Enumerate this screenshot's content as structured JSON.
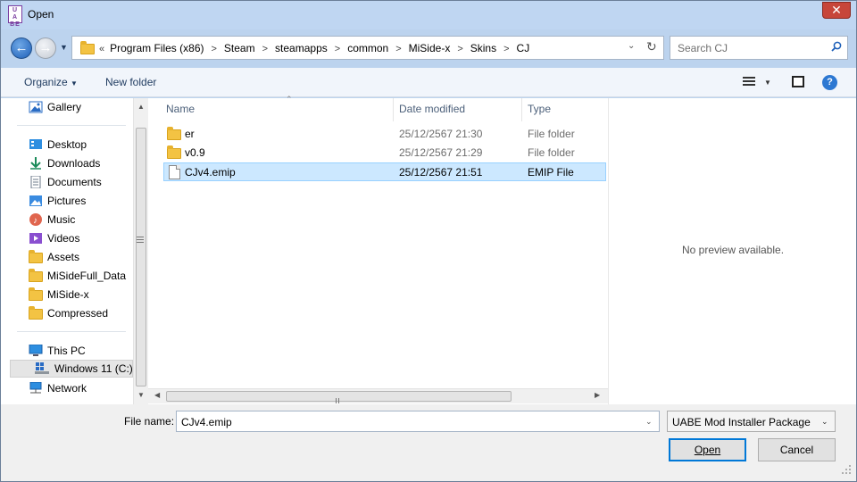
{
  "window": {
    "title": "Open",
    "app_icon_text": "UABE",
    "close_label": "✕"
  },
  "address": {
    "prefix": "«",
    "crumbs": [
      "Program Files (x86)",
      "Steam",
      "steamapps",
      "common",
      "MiSide-x",
      "Skins",
      "CJ"
    ]
  },
  "search": {
    "placeholder": "Search CJ"
  },
  "toolbar": {
    "organize_label": "Organize",
    "new_folder_label": "New folder"
  },
  "nav": {
    "items": [
      {
        "label": "Gallery",
        "icon": "gallery-icon"
      },
      {
        "label": "Desktop",
        "icon": "desktop-icon"
      },
      {
        "label": "Downloads",
        "icon": "download-icon"
      },
      {
        "label": "Documents",
        "icon": "documents-icon"
      },
      {
        "label": "Pictures",
        "icon": "pictures-icon"
      },
      {
        "label": "Music",
        "icon": "music-icon"
      },
      {
        "label": "Videos",
        "icon": "videos-icon"
      },
      {
        "label": "Assets",
        "icon": "folder-icon"
      },
      {
        "label": "MiSideFull_Data",
        "icon": "folder-icon"
      },
      {
        "label": "MiSide-x",
        "icon": "folder-icon"
      },
      {
        "label": "Compressed",
        "icon": "folder-icon"
      },
      {
        "label": "This PC",
        "icon": "computer-icon"
      },
      {
        "label": "Windows 11 (C:)",
        "icon": "drive-icon"
      },
      {
        "label": "Network",
        "icon": "network-icon"
      }
    ]
  },
  "file_list": {
    "columns": [
      "Name",
      "Date modified",
      "Type"
    ],
    "rows": [
      {
        "name": "er",
        "date": "25/12/2567 21:30",
        "type": "File folder",
        "kind": "folder",
        "selected": false
      },
      {
        "name": "v0.9",
        "date": "25/12/2567 21:29",
        "type": "File folder",
        "kind": "folder",
        "selected": false
      },
      {
        "name": "CJv4.emip",
        "date": "25/12/2567 21:51",
        "type": "EMIP File",
        "kind": "file",
        "selected": true
      }
    ]
  },
  "preview": {
    "message": "No preview available."
  },
  "footer": {
    "file_name_label": "File name:",
    "file_name_value": "CJv4.emip",
    "file_type_value": "UABE Mod Installer Package (*.",
    "open_label": "Open",
    "cancel_label": "Cancel"
  }
}
